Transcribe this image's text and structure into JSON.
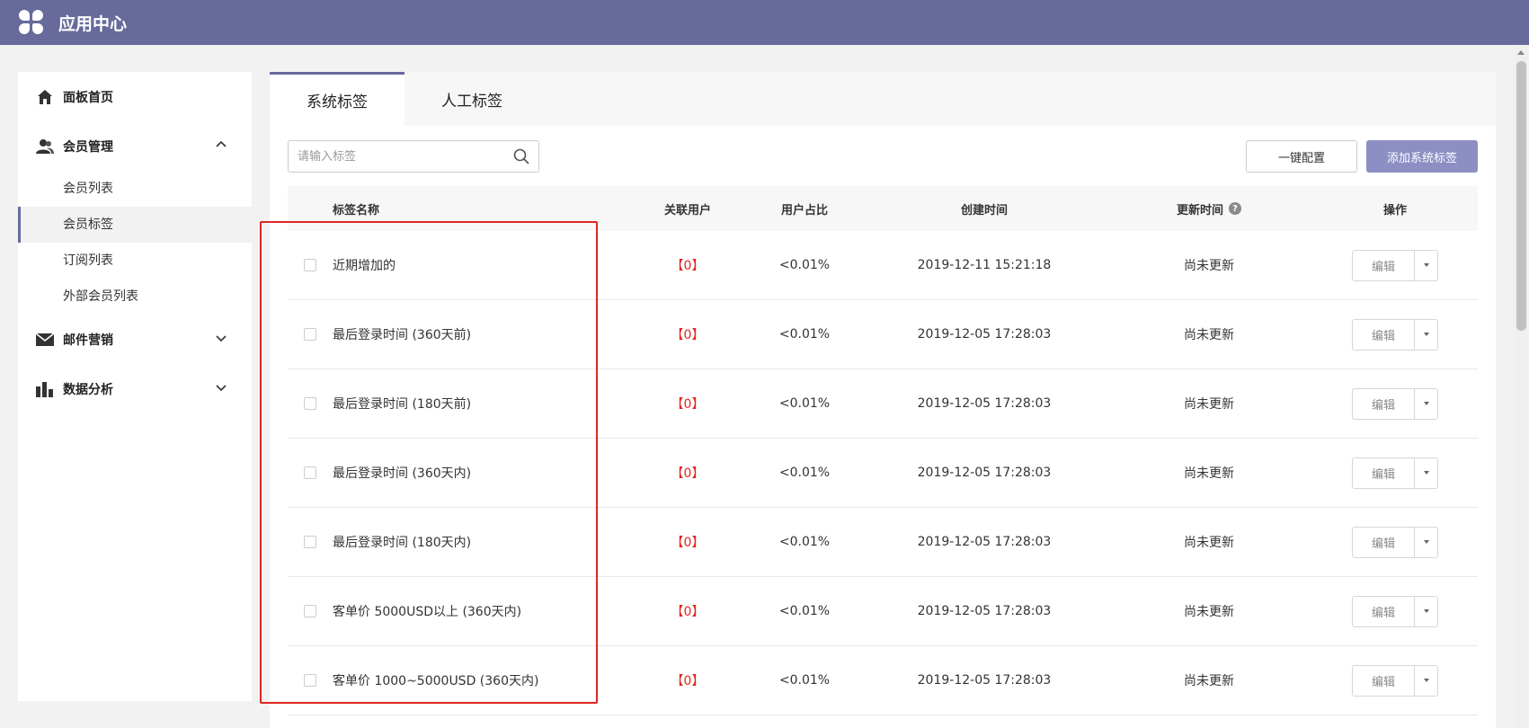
{
  "app": {
    "title": "应用中心"
  },
  "sidebar": {
    "groups": [
      {
        "label": "面板首页",
        "icon": "home-icon"
      },
      {
        "label": "会员管理",
        "icon": "members-icon",
        "expanded": true,
        "items": [
          {
            "label": "会员列表"
          },
          {
            "label": "会员标签",
            "active": true
          },
          {
            "label": "订阅列表"
          },
          {
            "label": "外部会员列表"
          }
        ]
      },
      {
        "label": "邮件营销",
        "icon": "mail-icon",
        "expanded": false
      },
      {
        "label": "数据分析",
        "icon": "bar-chart-icon",
        "expanded": false
      }
    ]
  },
  "main": {
    "tabs": [
      {
        "label": "系统标签",
        "active": true
      },
      {
        "label": "人工标签",
        "active": false
      }
    ],
    "search": {
      "placeholder": "请输入标签",
      "value": ""
    },
    "buttons": {
      "config": "一键配置",
      "add": "添加系统标签"
    },
    "table": {
      "headers": {
        "name": "标签名称",
        "users": "关联用户",
        "ratio": "用户占比",
        "created": "创建时间",
        "updated": "更新时间",
        "action": "操作"
      },
      "rows": [
        {
          "name": "近期增加的",
          "users": "【0】",
          "ratio": "<0.01%",
          "created": "2019-12-11 15:21:18",
          "updated": "尚未更新",
          "action": "编辑"
        },
        {
          "name": "最后登录时间 (360天前)",
          "users": "【0】",
          "ratio": "<0.01%",
          "created": "2019-12-05 17:28:03",
          "updated": "尚未更新",
          "action": "编辑"
        },
        {
          "name": "最后登录时间 (180天前)",
          "users": "【0】",
          "ratio": "<0.01%",
          "created": "2019-12-05 17:28:03",
          "updated": "尚未更新",
          "action": "编辑"
        },
        {
          "name": "最后登录时间 (360天内)",
          "users": "【0】",
          "ratio": "<0.01%",
          "created": "2019-12-05 17:28:03",
          "updated": "尚未更新",
          "action": "编辑"
        },
        {
          "name": "最后登录时间 (180天内)",
          "users": "【0】",
          "ratio": "<0.01%",
          "created": "2019-12-05 17:28:03",
          "updated": "尚未更新",
          "action": "编辑"
        },
        {
          "name": "客单价 5000USD以上 (360天内)",
          "users": "【0】",
          "ratio": "<0.01%",
          "created": "2019-12-05 17:28:03",
          "updated": "尚未更新",
          "action": "编辑"
        },
        {
          "name": "客单价 1000~5000USD (360天内)",
          "users": "【0】",
          "ratio": "<0.01%",
          "created": "2019-12-05 17:28:03",
          "updated": "尚未更新",
          "action": "编辑"
        }
      ]
    }
  },
  "colors": {
    "topbar": "#676a9b",
    "accent": "#8d8fc4",
    "highlight": "#e0271f",
    "count": "#e0271f"
  }
}
